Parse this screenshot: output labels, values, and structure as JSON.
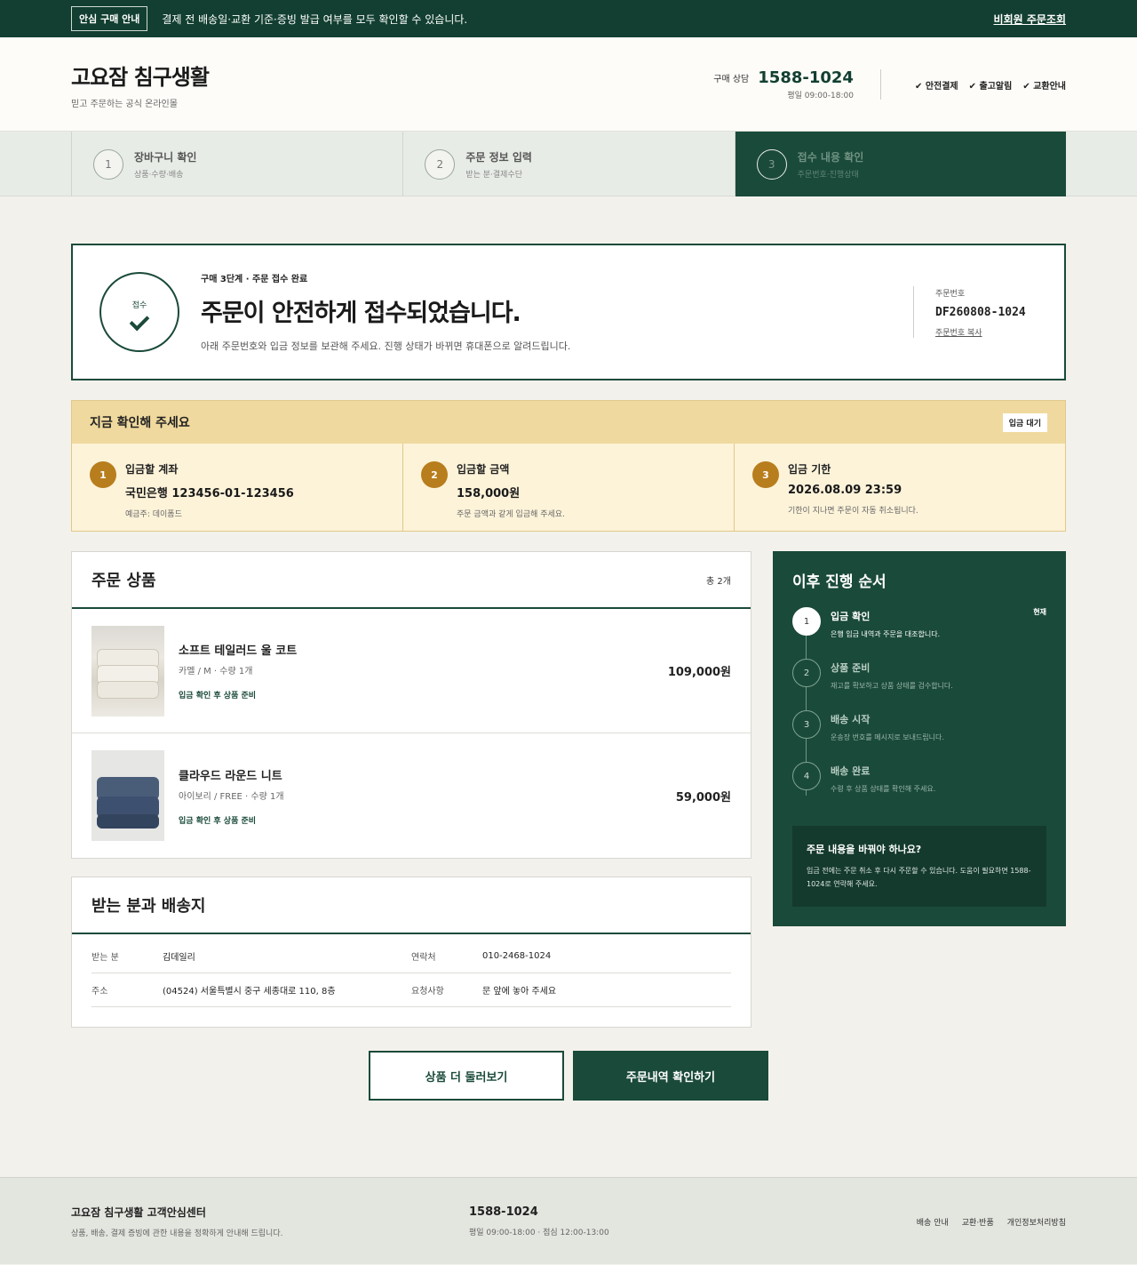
{
  "topbar": {
    "badge": "안심 구매 안내",
    "notice": "결제 전 배송일·교환 기준·증빙 발급 여부를 모두 확인할 수 있습니다.",
    "link": "비회원 주문조회"
  },
  "header": {
    "brand": "고요잠 침구생활",
    "tagline": "믿고 주문하는 공식 온라인몰",
    "cs_label": "구매 상담",
    "cs_phone": "1588-1024",
    "cs_hours": "평일 09:00-18:00",
    "trust": [
      "안전결제",
      "출고알림",
      "교환안내"
    ]
  },
  "steps": [
    {
      "num": "1",
      "title": "장바구니 확인",
      "sub": "상품·수량·배송"
    },
    {
      "num": "2",
      "title": "주문 정보 입력",
      "sub": "받는 분·결제수단"
    },
    {
      "num": "3",
      "title": "접수 내용 확인",
      "sub": "주문번호·진행상태"
    }
  ],
  "confirm": {
    "badge": "접수",
    "kicker": "구매 3단계 · 주문 접수 완료",
    "title": "주문이 안전하게 접수되었습니다.",
    "desc": "아래 주문번호와 입금 정보를 보관해 주세요. 진행 상태가 바뀌면 휴대폰으로 알려드립니다.",
    "order_label": "주문번호",
    "order_no": "DF260808-1024",
    "copy": "주문번호 복사"
  },
  "checknow": {
    "title": "지금 확인해 주세요",
    "badge": "입금 대기",
    "items": [
      {
        "num": "1",
        "label": "입금할 계좌",
        "value": "국민은행 123456-01-123456",
        "note": "예금주: 데이폼드"
      },
      {
        "num": "2",
        "label": "입금할 금액",
        "value": "158,000원",
        "note": "주문 금액과 같게 입금해 주세요."
      },
      {
        "num": "3",
        "label": "입금 기한",
        "value": "2026.08.09 23:59",
        "note": "기한이 지나면 주문이 자동 취소됩니다."
      }
    ]
  },
  "products": {
    "title": "주문 상품",
    "count": "총 2개",
    "items": [
      {
        "name": "소프트 테일러드 울 코트",
        "option": "카멜 / M · 수량 1개",
        "status": "입금 확인 후 상품 준비",
        "price": "109,000원"
      },
      {
        "name": "클라우드 라운드 니트",
        "option": "아이보리 / FREE · 수량 1개",
        "status": "입금 확인 후 상품 준비",
        "price": "59,000원"
      }
    ]
  },
  "shipping": {
    "title": "받는 분과 배송지",
    "rows": [
      {
        "k1": "받는 분",
        "v1": "김데일리",
        "k2": "연락처",
        "v2": "010-2468-1024"
      },
      {
        "k1": "주소",
        "v1": "(04524) 서울특별시 중구 세종대로 110, 8층",
        "k2": "요청사항",
        "v2": "문 앞에 놓아 주세요"
      }
    ]
  },
  "flow": {
    "title": "이후 진행 순서",
    "now": "현재",
    "items": [
      {
        "num": "1",
        "title": "입금 확인",
        "desc": "은행 입금 내역과 주문을 대조합니다."
      },
      {
        "num": "2",
        "title": "상품 준비",
        "desc": "재고를 확보하고 상품 상태를 검수합니다."
      },
      {
        "num": "3",
        "title": "배송 시작",
        "desc": "운송장 번호를 메시지로 보내드립니다."
      },
      {
        "num": "4",
        "title": "배송 완료",
        "desc": "수령 후 상품 상태를 확인해 주세요."
      }
    ],
    "notice_title": "주문 내용을 바꿔야 하나요?",
    "notice_desc": "입금 전에는 주문 취소 후 다시 주문할 수 있습니다. 도움이 필요하면 1588-1024로 연락해 주세요."
  },
  "actions": {
    "browse": "상품 더 둘러보기",
    "history": "주문내역 확인하기"
  },
  "footer": {
    "title": "고요잠 침구생활 고객안심센터",
    "sub": "상품, 배송, 결제 증빙에 관한 내용을 정확하게 안내해 드립니다.",
    "phone": "1588-1024",
    "hours": "평일 09:00-18:00 · 점심 12:00-13:00",
    "links": [
      "배송 안내",
      "교환·반품",
      "개인정보처리방침"
    ]
  },
  "colors": {
    "primary": "#1a4a3a",
    "topbar": "#123f31",
    "accent": "#b87d1d",
    "warning_bg": "#fdf3d9"
  }
}
